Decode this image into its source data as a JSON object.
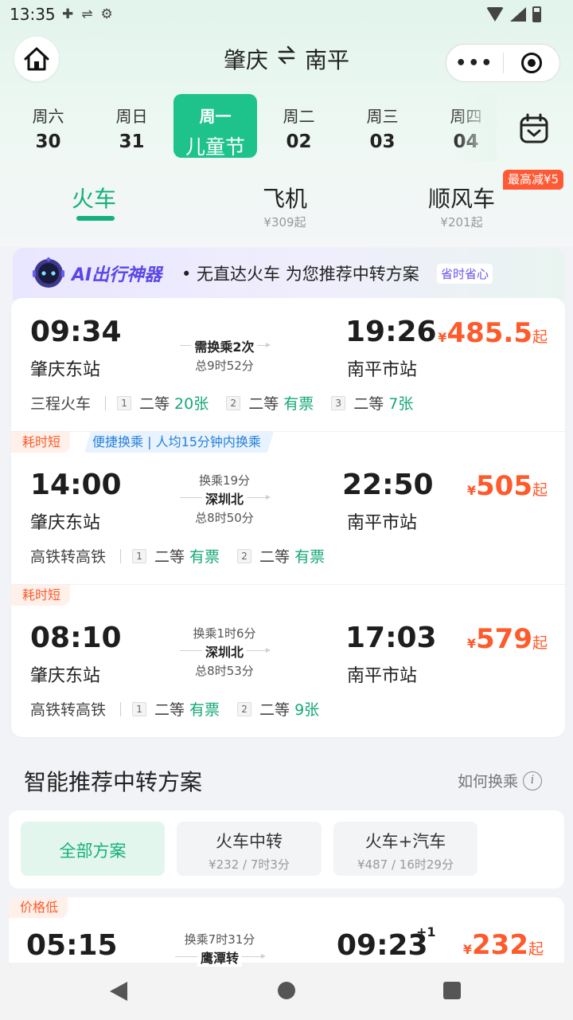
{
  "status_bar": {
    "time": "13:35"
  },
  "header": {
    "origin": "肇庆",
    "swap_icon": "swap-arrows-icon",
    "destination": "南平",
    "more_label": "•••"
  },
  "dates": [
    {
      "weekday": "周六",
      "day": "30"
    },
    {
      "weekday": "周日",
      "day": "31"
    },
    {
      "weekday": "周一",
      "day": "儿童节",
      "selected": true
    },
    {
      "weekday": "周二",
      "day": "02"
    },
    {
      "weekday": "周三",
      "day": "03"
    },
    {
      "weekday": "周四",
      "day": "04"
    }
  ],
  "modes": [
    {
      "label": "火车",
      "sub": "",
      "active": true
    },
    {
      "label": "飞机",
      "sub": "¥309起"
    },
    {
      "label": "顺风车",
      "sub": "¥201起"
    }
  ],
  "promo_badge": "最高减¥5",
  "ai_banner": {
    "brand": "AI出行神器",
    "text": "• 无直达火车 为您推荐中转方案",
    "chip": "省时省心"
  },
  "trips": [
    {
      "dep_time": "09:34",
      "dep_station": "肇庆东站",
      "transfer_above": "",
      "transfer_station": "需换乘2次",
      "duration": "总9时52分",
      "arr_time": "19:26",
      "arr_station": "南平市站",
      "price_currency": "¥",
      "price": "485.5",
      "price_suffix": "起",
      "train_type": "三程火车",
      "seats": [
        {
          "num": "1",
          "class": "二等",
          "avail": "20张"
        },
        {
          "num": "2",
          "class": "二等",
          "avail": "有票"
        },
        {
          "num": "3",
          "class": "二等",
          "avail": "7张"
        }
      ]
    },
    {
      "tag": "耗时短",
      "tag_extra": "便捷换乘 | 人均15分钟内换乘",
      "dep_time": "14:00",
      "dep_station": "肇庆东站",
      "transfer_above": "换乘19分",
      "transfer_station": "深圳北",
      "duration": "总8时50分",
      "arr_time": "22:50",
      "arr_station": "南平市站",
      "price_currency": "¥",
      "price": "505",
      "price_suffix": "起",
      "train_type": "高铁转高铁",
      "seats": [
        {
          "num": "1",
          "class": "二等",
          "avail": "有票"
        },
        {
          "num": "2",
          "class": "二等",
          "avail": "有票"
        }
      ]
    },
    {
      "tag": "耗时短",
      "dep_time": "08:10",
      "dep_station": "肇庆东站",
      "transfer_above": "换乘1时6分",
      "transfer_station": "深圳北",
      "duration": "总8时53分",
      "arr_time": "17:03",
      "arr_station": "南平市站",
      "price_currency": "¥",
      "price": "579",
      "price_suffix": "起",
      "train_type": "高铁转高铁",
      "seats": [
        {
          "num": "1",
          "class": "二等",
          "avail": "有票"
        },
        {
          "num": "2",
          "class": "二等",
          "avail": "9张"
        }
      ]
    }
  ],
  "smart": {
    "title": "智能推荐中转方案",
    "how_link": "如何换乘",
    "filters": [
      {
        "label": "全部方案",
        "sub": "",
        "active": true
      },
      {
        "label": "火车中转",
        "sub": "¥232 / 7时3分"
      },
      {
        "label": "火车+汽车",
        "sub": "¥487 / 16时29分"
      }
    ],
    "preview": {
      "tag": "价格低",
      "dep_time": "05:15",
      "transfer_above": "换乘7时31分",
      "transfer_station": "鹰潭转",
      "arr_time": "09:23",
      "arr_day_offset": "+1",
      "price_currency": "¥",
      "price": "232",
      "price_suffix": "起"
    }
  },
  "colors": {
    "accent": "#15b07c",
    "date_active": "#1ec28b",
    "price": "#ff5a2b",
    "ai_purple": "#5b46e8"
  }
}
